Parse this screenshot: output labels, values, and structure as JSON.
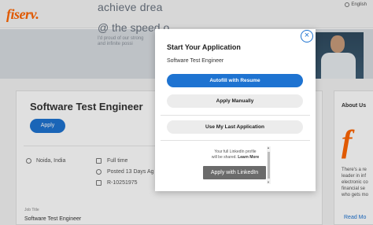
{
  "header": {
    "logo": "fiserv.",
    "language": "English"
  },
  "hero": {
    "line1": "achieve drea",
    "line2": "@ the speed o",
    "small1": "I'd proud of our strong",
    "small2": "and infinite possi"
  },
  "job": {
    "title": "Software Test Engineer",
    "apply_label": "Apply",
    "location": "Noida, India",
    "type": "Full time",
    "posted": "Posted 13 Days Ag",
    "req_id": "R-10251975",
    "field_label": "Job Title",
    "field_value": "Software Test Engineer"
  },
  "about": {
    "title": "About Us",
    "logo": "f",
    "lines": [
      "There's a re",
      "leader in inf",
      "electronic co",
      "financial se",
      "who gets mo"
    ],
    "read_more": "Read Mo"
  },
  "modal": {
    "title": "Start Your Application",
    "subtitle": "Software Test Engineer",
    "close_icon": "×",
    "autofill_label": "Autofill with Resume",
    "manual_label": "Apply Manually",
    "last_app_label": "Use My Last Application",
    "linkedin_note_line1": "Your full LinkedIn profile",
    "linkedin_note_line2a": "will be shared. ",
    "linkedin_note_line2b": "Learn More",
    "linkedin_button": "Apply with LinkedIn"
  },
  "colors": {
    "brand": "#ff6600",
    "primary": "#1e73d1"
  }
}
